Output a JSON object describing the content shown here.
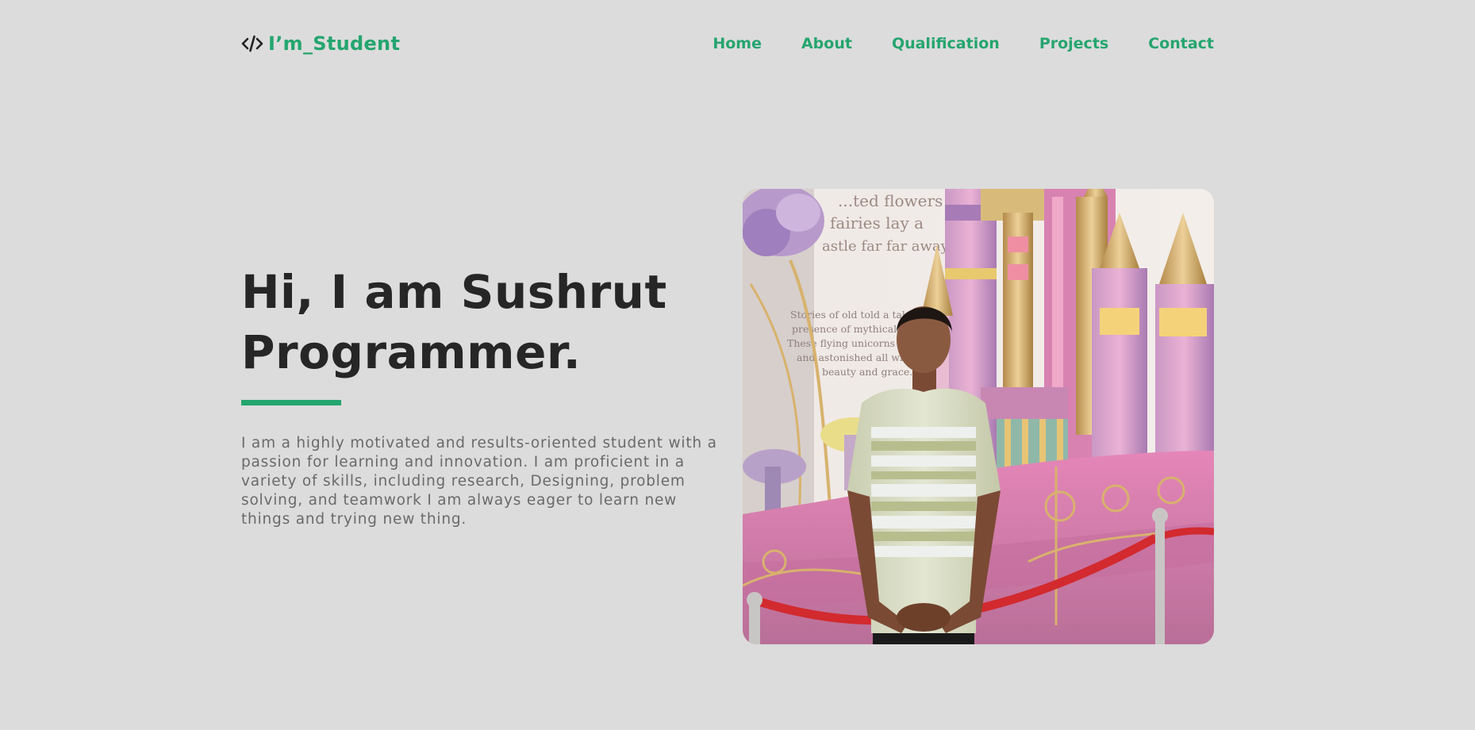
{
  "header": {
    "brand_icon": "code-icon",
    "brand_name": "I’m_Student",
    "nav": [
      "Home",
      "About",
      "Qualification",
      "Projects",
      "Contact"
    ]
  },
  "hero": {
    "title_line1": "Hi, I am Sushrut",
    "title_line2": "Programmer.",
    "description": "I am a highly motivated and results-oriented student with a passion for learning and innovation. I am proficient in a variety of skills, including research, Designing, problem solving, and teamwork I am always eager to learn new things and trying new thing."
  },
  "photo": {
    "sign_top": [
      "...ted flowers",
      "fairies lay a",
      "astle far far away"
    ],
    "sign_body": [
      "Stories of old told a tale of the",
      "presence of mythical creatu...",
      "These flying unicorns astound",
      "and astonished all with their",
      "beauty and grace."
    ]
  },
  "colors": {
    "background": "#dcdcdc",
    "accent": "#25a56f",
    "heading": "#262626",
    "body_text": "#6a6a6a"
  }
}
